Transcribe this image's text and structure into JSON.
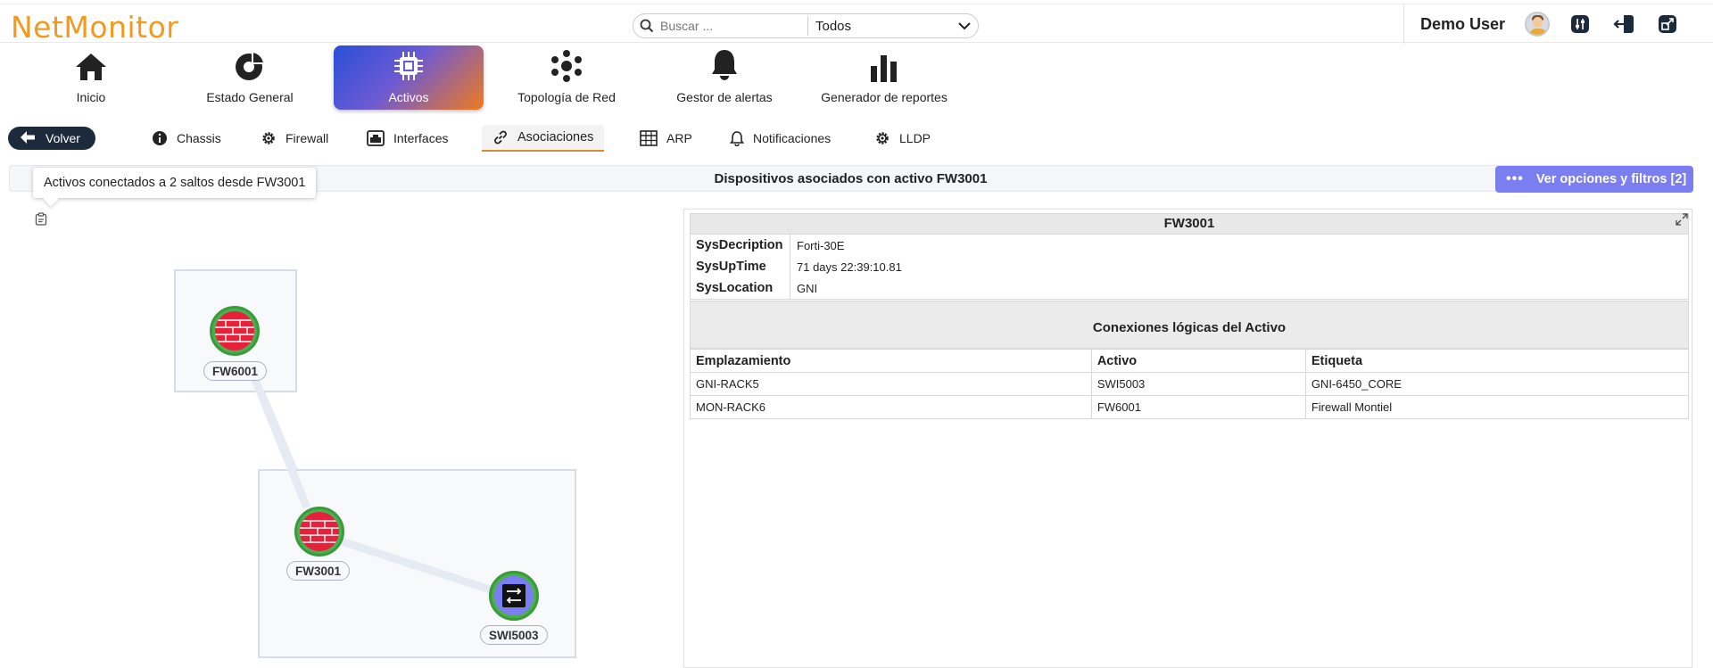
{
  "app": {
    "logo": "NetMonitor",
    "search_placeholder": "Buscar ...",
    "search_scope": "Todos",
    "user_name": "Demo User"
  },
  "main_nav": [
    {
      "label": "Inicio",
      "icon": "home-icon"
    },
    {
      "label": "Estado General",
      "icon": "pie-chart-icon"
    },
    {
      "label": "Activos",
      "icon": "chip-icon",
      "active": true
    },
    {
      "label": "Topología de Red",
      "icon": "network-icon"
    },
    {
      "label": "Gestor de alertas",
      "icon": "bell-icon"
    },
    {
      "label": "Generador de reportes",
      "icon": "bar-chart-icon"
    }
  ],
  "sub_nav": {
    "back_label": "Volver",
    "items": [
      {
        "label": "Chassis",
        "icon": "info-icon"
      },
      {
        "label": "Firewall",
        "icon": "gear-icon"
      },
      {
        "label": "Interfaces",
        "icon": "interface-icon"
      },
      {
        "label": "Asociaciones",
        "icon": "link-icon",
        "active": true
      },
      {
        "label": "ARP",
        "icon": "table-icon"
      },
      {
        "label": "Notificaciones",
        "icon": "bell-icon"
      },
      {
        "label": "LLDP",
        "icon": "gear-icon"
      }
    ]
  },
  "title_bar": {
    "title": "Dispositivos asociados con activo FW3001",
    "options_label": "Ver opciones y filtros [2]",
    "tooltip": "Activos conectados a 2 saltos desde FW3001"
  },
  "graph": {
    "nodes": [
      {
        "id": "FW6001",
        "type": "firewall"
      },
      {
        "id": "FW3001",
        "type": "firewall"
      },
      {
        "id": "SWI5003",
        "type": "switch"
      }
    ]
  },
  "detail": {
    "title": "FW3001",
    "props": [
      {
        "key": "SysDecription",
        "value": "Forti-30E"
      },
      {
        "key": "SysUpTime",
        "value": "71 days 22:39:10.81"
      },
      {
        "key": "SysLocation",
        "value": "GNI"
      }
    ],
    "connections_title": "Conexiones lógicas del Activo",
    "columns": [
      "Emplazamiento",
      "Activo",
      "Etiqueta"
    ],
    "rows": [
      [
        "GNI-RACK5",
        "SWI5003",
        "GNI-6450_CORE"
      ],
      [
        "MON-RACK6",
        "FW6001",
        "Firewall Montiel"
      ]
    ]
  },
  "colors": {
    "logo": "#f29a1f",
    "accent": "#7b7ef0",
    "node_border": "#3a9b3a",
    "back_button": "#1c2a3c"
  }
}
